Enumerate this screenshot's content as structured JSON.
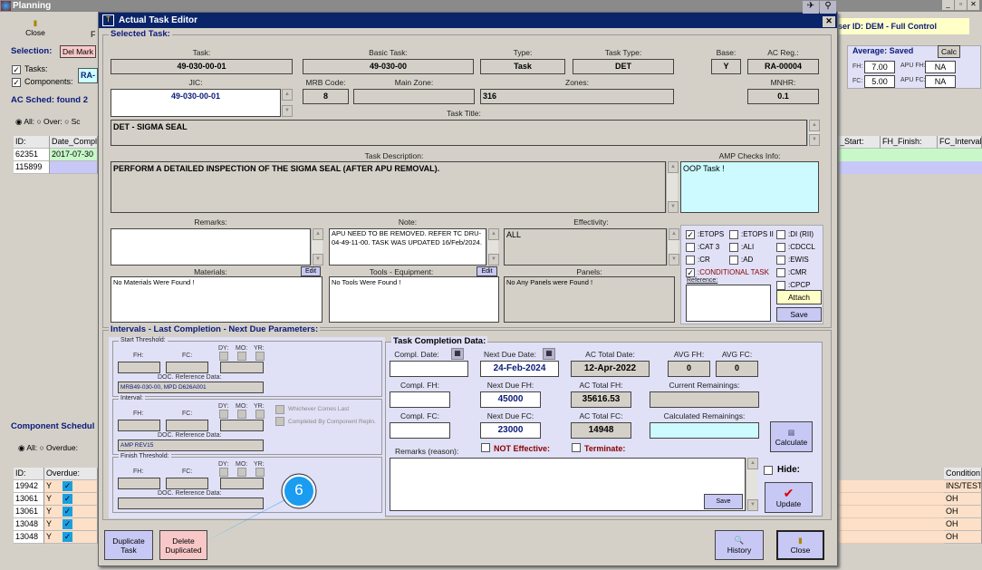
{
  "app": {
    "title": "Planning",
    "close_label": "Close",
    "f_label": "F",
    "user_info": "ser ID: DEM - Full Control",
    "selection_label": "Selection:",
    "del_mark": "Del Mark",
    "tasks_label": "Tasks:",
    "components_label": "Components:",
    "ac_reg_short": "RA-",
    "ac_sched": "AC Sched: found  2",
    "radio_all": "All:",
    "radio_over": "Over:",
    "radio_sc": "Sc",
    "table_headers": [
      "ID:",
      "Date_Compl:"
    ],
    "rows": [
      [
        "62351",
        "2017-07-30"
      ],
      [
        "115899",
        ""
      ]
    ],
    "right_headers": [
      "_Start:",
      "FH_Finish:",
      "FC_Interval"
    ],
    "average": {
      "title": "Average: Saved",
      "calc": "Calc",
      "fh_label": "FH:",
      "fh": "7.00",
      "fc_label": "FC:",
      "fc": "5.00",
      "apu_fh_label": "APU FH:",
      "apu_fh": "NA",
      "apu_fc_label": "APU FC:",
      "apu_fc": "NA"
    },
    "comp_sched": "Component Schedul",
    "comp_all": "All:",
    "comp_overdue": "Overdue:",
    "comp_headers": [
      "ID:",
      "Overdue:"
    ],
    "comp_rows": [
      [
        "19942",
        "Y"
      ],
      [
        "13061",
        "Y"
      ],
      [
        "13061",
        "Y"
      ],
      [
        "13048",
        "Y"
      ],
      [
        "13048",
        "Y"
      ]
    ],
    "condition_header": "Condition:",
    "conditions": [
      "INS/TEST",
      "OH",
      "OH",
      "OH",
      "OH"
    ]
  },
  "dialog": {
    "title": "Actual Task Editor",
    "selected_task": "Selected Task:",
    "labels": {
      "task": "Task:",
      "basic_task": "Basic Task:",
      "type": "Type:",
      "task_type": "Task Type:",
      "base": "Base:",
      "ac_reg": "AC Reg.:",
      "jic": "JIC:",
      "mrb": "MRB Code:",
      "main_zone": "Main Zone:",
      "zones": "Zones:",
      "mnhr": "MNHR:",
      "task_title": "Task Title:",
      "task_desc": "Task Description:",
      "amp": "AMP Checks Info:",
      "remarks": "Remarks:",
      "note": "Note:",
      "effectivity": "Effectivity:",
      "materials": "Materials:",
      "tools": "Tools - Equipment:",
      "panels": "Panels:",
      "edit": "Edit",
      "reference": "Reference:"
    },
    "values": {
      "task": "49-030-00-01",
      "basic_task": "49-030-00",
      "type": "Task",
      "task_type": "DET",
      "base": "Y",
      "ac_reg": "RA-00004",
      "jic": "49-030-00-01",
      "mrb": "8",
      "main_zone": "",
      "zones": "316",
      "mnhr": "0.1",
      "task_title": "DET - SIGMA SEAL",
      "task_desc": "PERFORM A DETAILED INSPECTION OF THE SIGMA SEAL (AFTER APU REMOVAL).",
      "amp": "OOP Task !",
      "remarks": "",
      "note": "APU NEED TO BE REMOVED. REFER TC DRU-04-49-11-00. TASK WAS UPDATED 16/Feb/2024.",
      "effectivity": "ALL",
      "materials": "No Materials Were Found !",
      "tools": "No Tools Were Found !",
      "panels": "No Any Panels were Found !"
    },
    "checks": [
      {
        "label": ":ETOPS",
        "checked": true
      },
      {
        "label": ":ETOPS II",
        "checked": false
      },
      {
        "label": ":DI (RII)",
        "checked": false
      },
      {
        "label": ":CAT 3",
        "checked": false
      },
      {
        "label": ":ALI",
        "checked": false
      },
      {
        "label": ":CDCCL",
        "checked": false
      },
      {
        "label": ":CR",
        "checked": false
      },
      {
        "label": ":AD",
        "checked": false
      },
      {
        "label": ":EWIS",
        "checked": false
      },
      {
        "label": ":CONDITIONAL TASK",
        "checked": true
      },
      {
        "label": ":CMR",
        "checked": false
      },
      {
        "label": ":CPCP",
        "checked": false
      }
    ],
    "attach": "Attach",
    "save": "Save",
    "intervals": {
      "title": "Intervals - Last Completion - Next Due Parameters:",
      "start": "Start Threshold:",
      "interval": "Interval:",
      "finish": "Finish Threshold:",
      "fh": "FH:",
      "fc": "FC:",
      "dy": "DY:",
      "mo": "MO:",
      "yr": "YR:",
      "doc_ref": "DOC. Reference Data:",
      "start_doc": "MRB49-030-00, MPD D626A001",
      "interval_doc": "AMP REV15",
      "finish_doc": "",
      "whichever": "Whichever Comes Last",
      "completed_by": "Completed By Component Repln."
    },
    "completion": {
      "title": "Task Completion Data:",
      "compl_date": "Compl. Date:",
      "next_due_date": "Next Due Date:",
      "next_due_date_val": "24-Feb-2024",
      "ac_total_date": "AC Total Date:",
      "ac_total_date_val": "12-Apr-2022",
      "avg_fh": "AVG FH:",
      "avg_fh_val": "0",
      "avg_fc": "AVG FC:",
      "avg_fc_val": "0",
      "compl_fh": "Compl. FH:",
      "next_due_fh": "Next Due FH:",
      "next_due_fh_val": "45000",
      "ac_total_fh": "AC Total FH:",
      "ac_total_fh_val": "35616.53",
      "current_rem": "Current Remainings:",
      "compl_fc": "Compl. FC:",
      "next_due_fc": "Next Due FC:",
      "next_due_fc_val": "23000",
      "ac_total_fc": "AC Total FC:",
      "ac_total_fc_val": "14948",
      "calc_rem": "Calculated Remainings:",
      "calculate": "Calculate",
      "remarks_reason": "Remarks (reason):",
      "not_effective": "NOT Effective:",
      "terminate": "Terminate:",
      "save": "Save",
      "hide": "Hide:",
      "update": "Update"
    },
    "buttons": {
      "duplicate": "Duplicate Task",
      "delete_dup": "Delete Duplicated",
      "history": "History",
      "close": "Close"
    }
  },
  "callout": {
    "number": "6",
    "color": "#1a9cf0"
  }
}
